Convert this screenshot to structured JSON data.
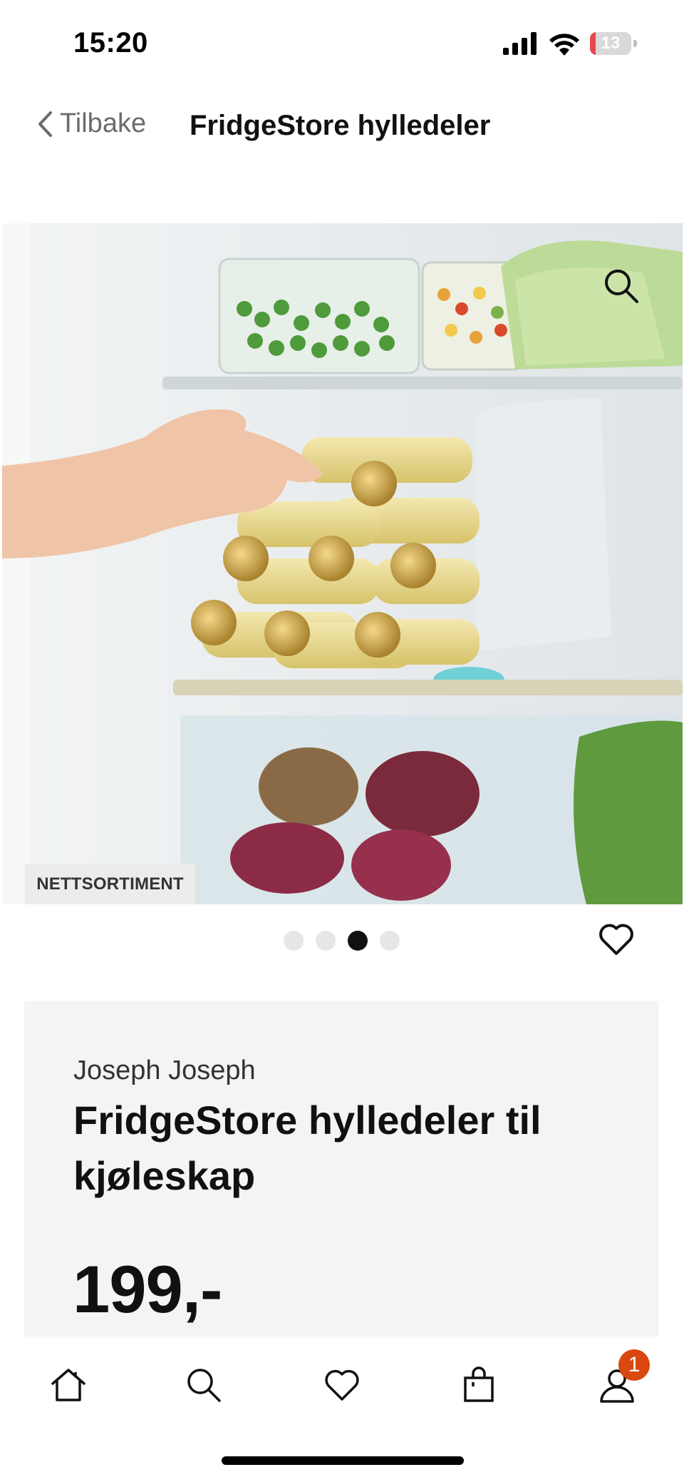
{
  "status_bar": {
    "time": "15:20",
    "battery_level": "13",
    "battery_fraction": 0.13
  },
  "header": {
    "back_label": "Tilbake",
    "title": "FridgeStore hylledeler"
  },
  "gallery": {
    "badge": "NETTSORTIMENT",
    "dot_count": 4,
    "active_dot": 2
  },
  "product": {
    "brand": "Joseph Joseph",
    "title": "FridgeStore hylledeler til kjøleskap",
    "price": "199,-"
  },
  "tab_bar": {
    "items": [
      "home-icon",
      "search-icon",
      "heart-icon",
      "shopping-bag-icon",
      "profile-icon"
    ],
    "profile_badge": "1"
  },
  "colors": {
    "badge_orange": "#d9480f",
    "card_background": "#f5f4f4",
    "battery_red": "#e5484d"
  }
}
